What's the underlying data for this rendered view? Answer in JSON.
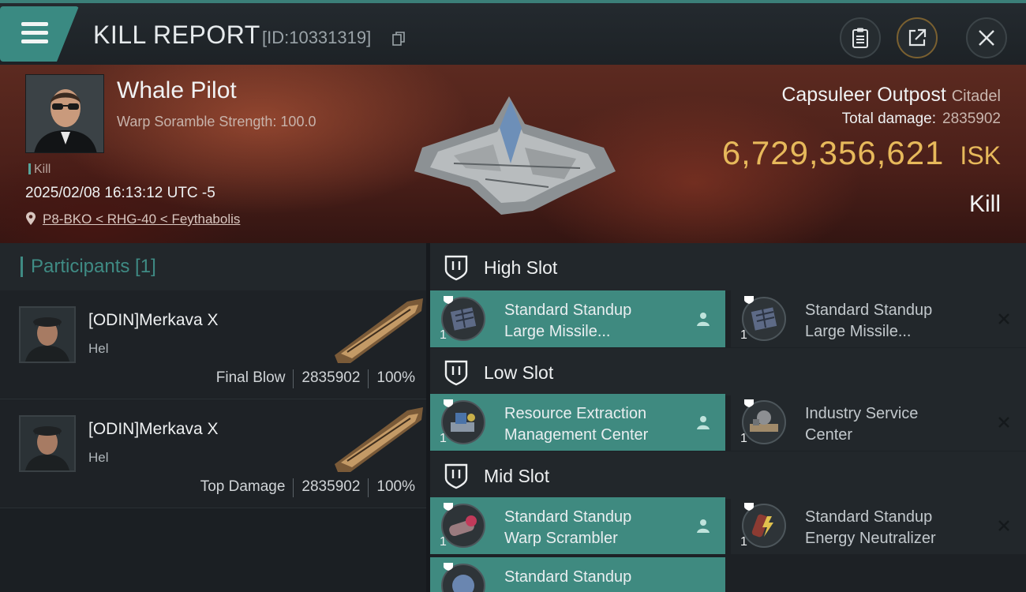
{
  "header": {
    "title": "KILL REPORT",
    "report_id": "[ID:10331319]",
    "buttons": [
      "clipboard-icon",
      "share-icon",
      "close-icon"
    ]
  },
  "victim": {
    "pilot_name": "Whale Pilot",
    "warp_scramble": "Warp Soramble Strength: 100.0",
    "kill_tag": "Kill",
    "datetime": "2025/02/08 16:13:12 UTC -5",
    "location": "P8-BKO < RHG-40 < Feythabolis",
    "structure_name": "Capsuleer Outpost",
    "structure_type": "Citadel",
    "total_damage_label": "Total damage:",
    "total_damage_value": "2835902",
    "isk_value": "6,729,356,621",
    "isk_unit": "ISK",
    "result": "Kill"
  },
  "participants": {
    "title": "Participants [1]",
    "rows": [
      {
        "name": "[ODIN]Merkava X",
        "ship": "Hel",
        "role": "Final Blow",
        "damage": "2835902",
        "percent": "100%"
      },
      {
        "name": "[ODIN]Merkava X",
        "ship": "Hel",
        "role": "Top Damage",
        "damage": "2835902",
        "percent": "100%"
      }
    ]
  },
  "slots": {
    "high": {
      "label": "High Slot",
      "modules": [
        {
          "line1": "Standard Standup",
          "line2": "Large Missile...",
          "qty": "1",
          "state": "fitted"
        },
        {
          "line1": "Standard Standup",
          "line2": "Large Missile...",
          "qty": "1",
          "state": "destroyed"
        }
      ]
    },
    "low": {
      "label": "Low Slot",
      "modules": [
        {
          "line1": "Resource Extraction",
          "line2": "Management Center",
          "qty": "1",
          "state": "fitted"
        },
        {
          "line1": "Industry Service",
          "line2": "Center",
          "qty": "1",
          "state": "destroyed"
        }
      ]
    },
    "mid": {
      "label": "Mid Slot",
      "modules": [
        {
          "line1": "Standard Standup",
          "line2": "Warp Scrambler",
          "qty": "1",
          "state": "fitted"
        },
        {
          "line1": "Standard Standup",
          "line2": "Energy Neutralizer",
          "qty": "1",
          "state": "destroyed"
        },
        {
          "line1": "Standard Standup",
          "line2": "",
          "qty": "",
          "state": "fitted"
        }
      ]
    }
  },
  "colors": {
    "accent": "#3f8a80",
    "isk": "#e7b95b",
    "hero_bg": "#4a1f19"
  }
}
